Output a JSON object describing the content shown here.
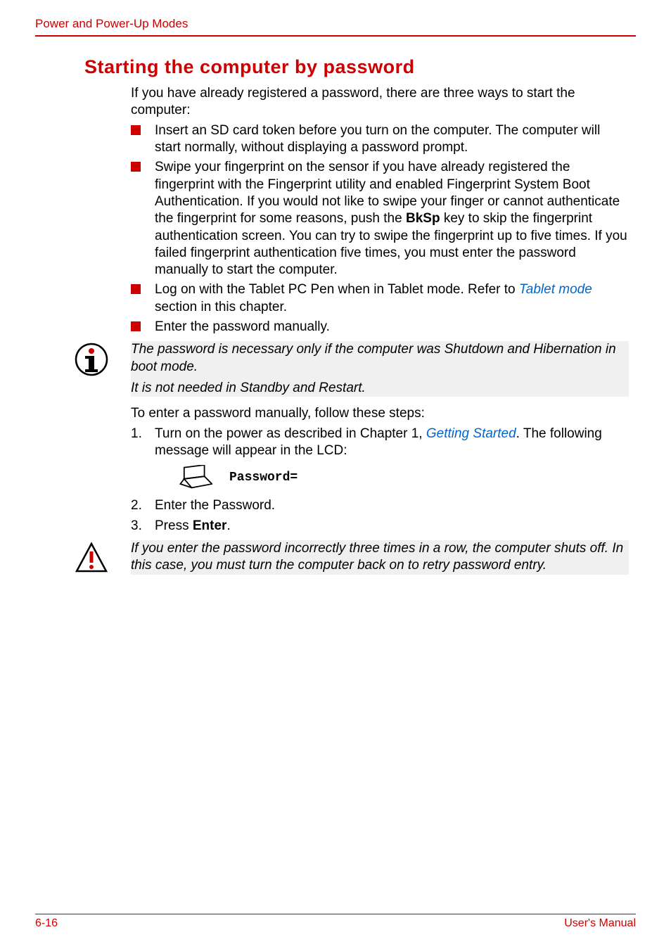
{
  "header": {
    "title": "Power and Power-Up Modes"
  },
  "section": {
    "heading": "Starting the computer by password",
    "intro": "If you have already registered a password, there are three ways to start the computer:",
    "bullets": [
      {
        "text": "Insert an SD card token before you turn on the computer. The computer will start normally, without displaying a password prompt."
      },
      {
        "pre": "Swipe your fingerprint on the sensor if you have already registered the fingerprint with the Fingerprint utility and enabled Fingerprint System Boot Authentication. If you would not like to swipe your finger or cannot authenticate the fingerprint for some reasons, push the ",
        "boldkey": "BkSp",
        "post": " key to skip the fingerprint authentication screen. You can try to swipe the fingerprint up to five times. If you failed fingerprint authentication five times, you must enter the password manually to start the computer."
      },
      {
        "pre": "Log on with the Tablet PC Pen when in Tablet mode. Refer to ",
        "linktext": "Tablet mode",
        "post": " section in this chapter."
      },
      {
        "text": "Enter the password manually."
      }
    ],
    "info_callout": {
      "line1": "The password is necessary only if the computer was Shutdown and Hibernation in boot mode.",
      "line2": "It is not needed in Standby and Restart."
    },
    "manual_intro": "To enter a password manually, follow these steps:",
    "steps": {
      "s1_pre": "Turn on the power as described in Chapter 1, ",
      "s1_link": "Getting Started",
      "s1_post": ". The following message will appear in the LCD:",
      "prompt": "Password=",
      "s2": "Enter the Password.",
      "s3_pre": "Press ",
      "s3_bold": "Enter",
      "s3_post": "."
    },
    "warning_callout": "If you enter the password incorrectly three times in a row, the computer shuts off. In this case, you must turn the computer back on to retry password entry."
  },
  "footer": {
    "left": "6-16",
    "right": "User's Manual"
  }
}
